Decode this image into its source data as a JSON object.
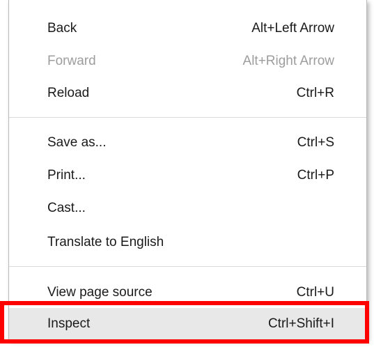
{
  "menu": {
    "items": [
      {
        "label": "Back",
        "shortcut": "Alt+Left Arrow",
        "enabled": true
      },
      {
        "label": "Forward",
        "shortcut": "Alt+Right Arrow",
        "enabled": false
      },
      {
        "label": "Reload",
        "shortcut": "Ctrl+R",
        "enabled": true
      },
      {
        "label": "Save as...",
        "shortcut": "Ctrl+S",
        "enabled": true
      },
      {
        "label": "Print...",
        "shortcut": "Ctrl+P",
        "enabled": true
      },
      {
        "label": "Cast...",
        "shortcut": "",
        "enabled": true
      },
      {
        "label": "Translate to English",
        "shortcut": "",
        "enabled": true
      },
      {
        "label": "View page source",
        "shortcut": "Ctrl+U",
        "enabled": true
      },
      {
        "label": "Inspect",
        "shortcut": "Ctrl+Shift+I",
        "enabled": true,
        "highlighted": true
      }
    ]
  },
  "annotation": {
    "highlight_color": "#ff0000",
    "highlighted_item": "Inspect"
  }
}
